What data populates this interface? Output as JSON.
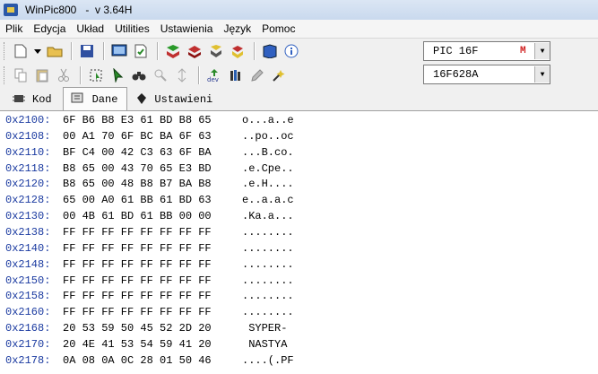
{
  "window": {
    "title": "WinPic800   -  v 3.64H"
  },
  "menu": [
    "Plik",
    "Edycja",
    "Układ",
    "Utilities",
    "Ustawienia",
    "Język",
    "Pomoc"
  ],
  "device": {
    "family": "PIC 16F",
    "model": "16F628A"
  },
  "tabs": [
    {
      "label": "Kod",
      "icon": "code-chip-icon"
    },
    {
      "label": "Dane",
      "icon": "data-eeprom-icon"
    },
    {
      "label": "Ustawieni",
      "icon": "settings-icon"
    }
  ],
  "active_tab": "Dane",
  "hex": [
    {
      "addr": "0x2100:",
      "bytes": "6F B6 B8 E3 61 BD B8 65",
      "ascii": "o...a..e"
    },
    {
      "addr": "0x2108:",
      "bytes": "00 A1 70 6F BC BA 6F 63",
      "ascii": "..po..oc"
    },
    {
      "addr": "0x2110:",
      "bytes": "BF C4 00 42 C3 63 6F BA",
      "ascii": "...B.co."
    },
    {
      "addr": "0x2118:",
      "bytes": "B8 65 00 43 70 65 E3 BD",
      "ascii": ".e.Cpe.."
    },
    {
      "addr": "0x2120:",
      "bytes": "B8 65 00 48 B8 B7 BA B8",
      "ascii": ".e.H...."
    },
    {
      "addr": "0x2128:",
      "bytes": "65 00 A0 61 BB 61 BD 63",
      "ascii": "e..a.a.c"
    },
    {
      "addr": "0x2130:",
      "bytes": "00 4B 61 BD 61 BB 00 00",
      "ascii": ".Ka.a..."
    },
    {
      "addr": "0x2138:",
      "bytes": "FF FF FF FF FF FF FF FF",
      "ascii": "........"
    },
    {
      "addr": "0x2140:",
      "bytes": "FF FF FF FF FF FF FF FF",
      "ascii": "........"
    },
    {
      "addr": "0x2148:",
      "bytes": "FF FF FF FF FF FF FF FF",
      "ascii": "........"
    },
    {
      "addr": "0x2150:",
      "bytes": "FF FF FF FF FF FF FF FF",
      "ascii": "........"
    },
    {
      "addr": "0x2158:",
      "bytes": "FF FF FF FF FF FF FF FF",
      "ascii": "........"
    },
    {
      "addr": "0x2160:",
      "bytes": "FF FF FF FF FF FF FF FF",
      "ascii": "........"
    },
    {
      "addr": "0x2168:",
      "bytes": "20 53 59 50 45 52 2D 20",
      "ascii": " SYPER- "
    },
    {
      "addr": "0x2170:",
      "bytes": "20 4E 41 53 54 59 41 20",
      "ascii": " NASTYA "
    },
    {
      "addr": "0x2178:",
      "bytes": "0A 08 0A 0C 28 01 50 46",
      "ascii": "....(.PF"
    }
  ]
}
